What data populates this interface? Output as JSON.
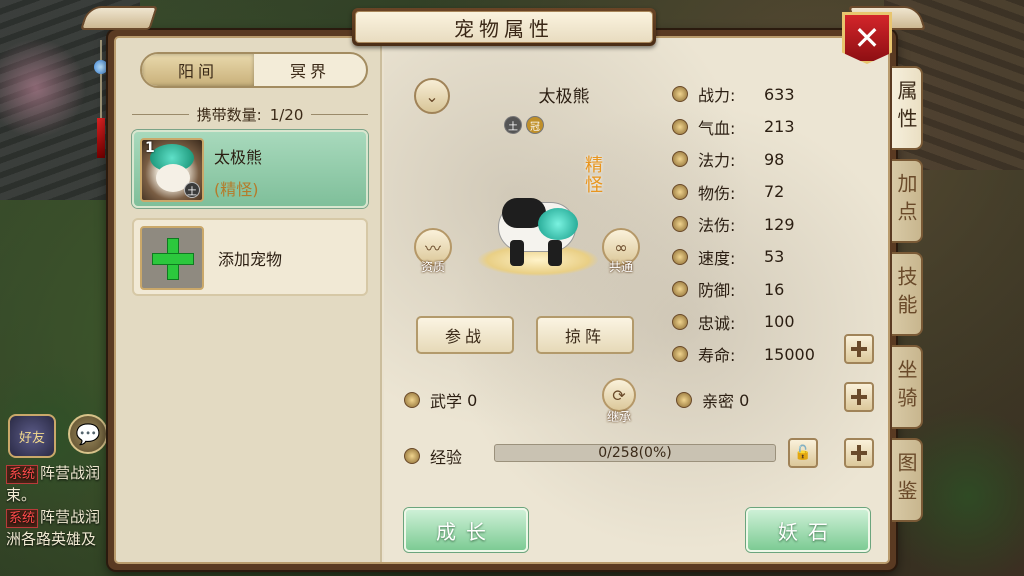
{
  "window": {
    "title": "宠物属性",
    "close_label": "✕"
  },
  "realm_tabs": [
    {
      "label": "阳间",
      "active": true
    },
    {
      "label": "冥界",
      "active": false
    }
  ],
  "carry": {
    "label": "携带数量:",
    "value": "1/20"
  },
  "pet_list": [
    {
      "level": "1",
      "name": "太极熊",
      "type": "(精怪)",
      "element": "土"
    }
  ],
  "add_pet_label": "添加宠物",
  "pet": {
    "name": "太极熊",
    "element_icons": [
      "土",
      "冠"
    ],
    "category": "精怪",
    "aptitude_label": "资质",
    "share_label": "共通"
  },
  "actions": {
    "fight_label": "参战",
    "formation_label": "掠阵",
    "inherit_label": "继承",
    "grow_label": "成长",
    "demon_stone_label": "妖石"
  },
  "stats": [
    {
      "label": "战力:",
      "value": "633"
    },
    {
      "label": "气血:",
      "value": "213"
    },
    {
      "label": "法力:",
      "value": "98"
    },
    {
      "label": "物伤:",
      "value": "72"
    },
    {
      "label": "法伤:",
      "value": "129"
    },
    {
      "label": "速度:",
      "value": "53"
    },
    {
      "label": "防御:",
      "value": "16"
    },
    {
      "label": "忠诚:",
      "value": "100"
    },
    {
      "label": "寿命:",
      "value": "15000"
    }
  ],
  "martial": {
    "label": "武学",
    "value": "0"
  },
  "intimacy": {
    "label": "亲密",
    "value": "0"
  },
  "experience": {
    "label": "经验",
    "text": "0/258(0%)",
    "progress": 0
  },
  "side_tabs": [
    {
      "label": "属性",
      "active": true
    },
    {
      "label": "加点",
      "active": false
    },
    {
      "label": "技能",
      "active": false
    },
    {
      "label": "坐骑",
      "active": false
    },
    {
      "label": "图鉴",
      "active": false
    }
  ],
  "chat": {
    "friend_label": "好友",
    "messages": [
      {
        "tag": "系统",
        "text": "阵营战润"
      },
      {
        "tag": "",
        "text": "束。"
      },
      {
        "tag": "系统",
        "text": "阵营战润"
      },
      {
        "tag": "",
        "text": "洲各路英雄及"
      }
    ]
  },
  "colors": {
    "accent_green": "#7dcb94",
    "close_red": "#c0181e",
    "frame_brown": "#5a3a22",
    "parchment": "#eae2cf"
  }
}
